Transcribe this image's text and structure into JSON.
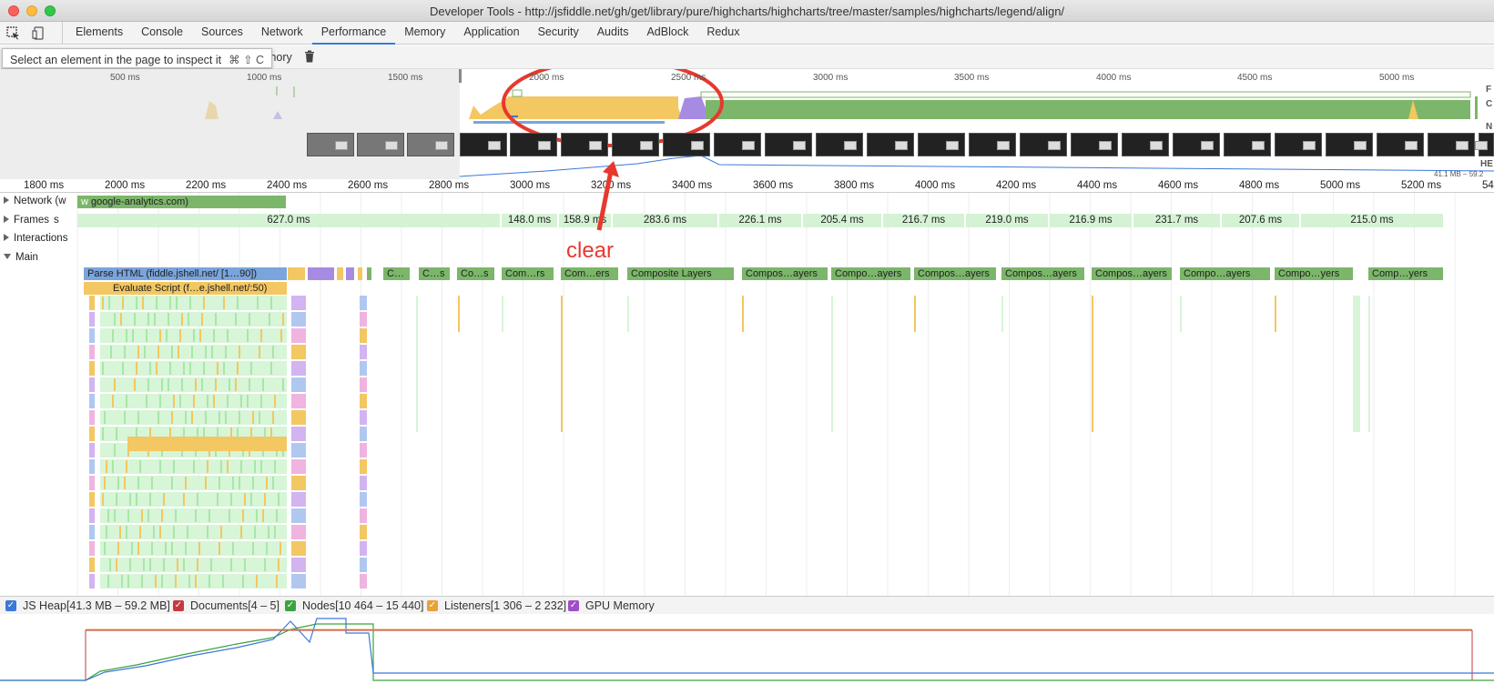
{
  "window": {
    "title": "Developer Tools - http://jsfiddle.net/gh/get/library/pure/highcharts/highcharts/tree/master/samples/highcharts/legend/align/"
  },
  "tabs": [
    "Elements",
    "Console",
    "Sources",
    "Network",
    "Performance",
    "Memory",
    "Application",
    "Security",
    "Audits",
    "AdBlock",
    "Redux"
  ],
  "active_tab": "Performance",
  "toolbar": {
    "tooltip": "Select an element in the page to inspect it",
    "shortcut": "⌘ ⇧ C",
    "memory_label": "emory"
  },
  "overview": {
    "ticks": [
      "500 ms",
      "1000 ms",
      "1500 ms",
      "2000 ms",
      "2500 ms",
      "3000 ms",
      "3500 ms",
      "4000 ms",
      "4500 ms",
      "5000 ms"
    ],
    "right_labels": [
      "F",
      "C",
      "N",
      "HE"
    ],
    "heap_label": "41.1 MB – 59.2"
  },
  "ruler": {
    "ticks": [
      "1800 ms",
      "2000 ms",
      "2200 ms",
      "2400 ms",
      "2600 ms",
      "2800 ms",
      "3000 ms",
      "3200 ms",
      "3400 ms",
      "3600 ms",
      "3800 ms",
      "4000 ms",
      "4200 ms",
      "4400 ms",
      "4600 ms",
      "4800 ms",
      "5000 ms",
      "5200 ms",
      "54"
    ]
  },
  "tracks": {
    "network": {
      "label": "Network",
      "partial": "(w",
      "partial2": "w",
      "request": "google-analytics.com)"
    },
    "frames": {
      "label": "Frames",
      "prefix": "s",
      "values": [
        "627.0 ms",
        "148.0 ms",
        "158.9 ms",
        "283.6 ms",
        "226.1 ms",
        "205.4 ms",
        "216.7 ms",
        "219.0 ms",
        "216.9 ms",
        "231.7 ms",
        "207.6 ms",
        "215.0 ms"
      ]
    },
    "interactions": {
      "label": "Interactions"
    },
    "main": {
      "label": "Main",
      "parse_html": "Parse HTML (fiddle.jshell.net/ [1…90])",
      "evaluate_script": "Evaluate Script (f…e.jshell.net/:50)",
      "composite": [
        "C…",
        "C…s",
        "Co…s",
        "Com…rs",
        "Com…ers",
        "Composite Layers",
        "Compos…ayers",
        "Compo…ayers",
        "Compos…ayers",
        "Compos…ayers",
        "Compos…ayers",
        "Compo…ayers",
        "Compo…yers",
        "Comp…yers"
      ]
    }
  },
  "legend": [
    {
      "label": "JS Heap[41.3 MB – 59.2 MB]",
      "color": "#3b78d8"
    },
    {
      "label": "Documents[4 – 5]",
      "color": "#c6393e"
    },
    {
      "label": "Nodes[10 464 – 15 440]",
      "color": "#3aa33f"
    },
    {
      "label": "Listeners[1 306 – 2 232]",
      "color": "#e6a23c"
    },
    {
      "label": "GPU Memory",
      "color": "#a24cc6"
    }
  ],
  "annotation": {
    "text": "clear",
    "color": "#e8382d"
  }
}
